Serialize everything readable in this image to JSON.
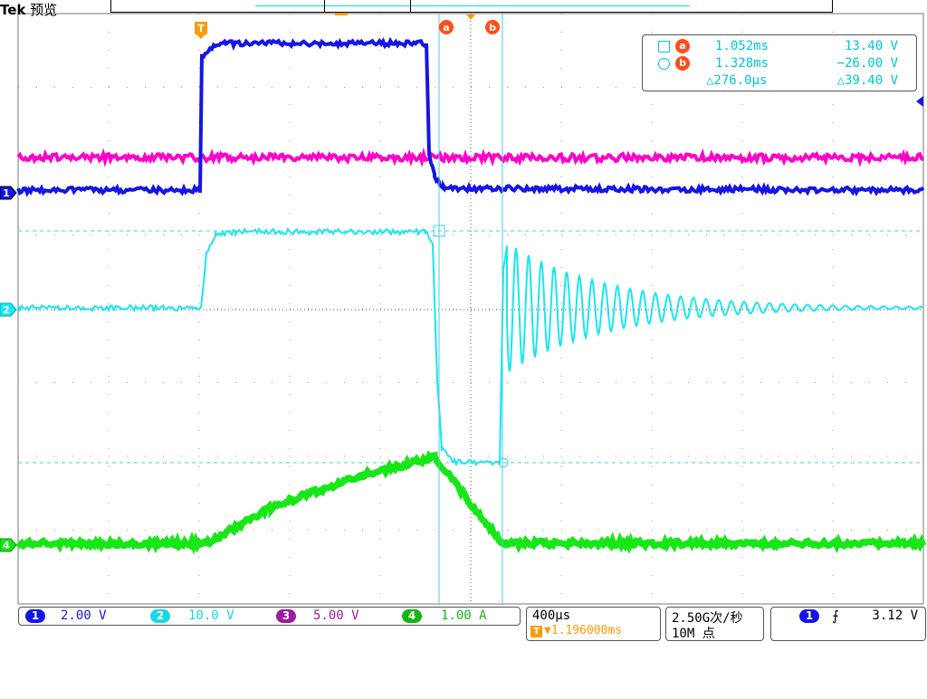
{
  "header": {
    "brand": "Tek",
    "mode": "预览"
  },
  "colors": {
    "ch1": "#1515e6",
    "ch2": "#19e6f0",
    "ch3": "#ff00cc",
    "ch4": "#17e617",
    "cursor": "#3fd2e6",
    "cursor_badge": "#ff4d1a",
    "trigger": "#ff9a0a",
    "grid": "#9a9a9a"
  },
  "markers": {
    "trigger_top": "T",
    "cursor_a": "a",
    "cursor_b": "b",
    "ch1": "1",
    "ch2": "2",
    "ch4": "4"
  },
  "measurements": {
    "a_time": "1.052ms",
    "a_value": "13.40 V",
    "b_time": "1.328ms",
    "b_value": "−26.00 V",
    "delta_time": "△276.0µs",
    "delta_value": "△39.40 V"
  },
  "channels": [
    {
      "num": "1",
      "scale": "2.00 V",
      "color": "#1515e6"
    },
    {
      "num": "2",
      "scale": "10.0 V",
      "color": "#19e6f0"
    },
    {
      "num": "3",
      "scale": "5.00 V",
      "color": "#9e1a9e"
    },
    {
      "num": "4",
      "scale": "1.00 A",
      "color": "#17c417"
    }
  ],
  "timebase": {
    "scale": "400µs",
    "position": "▼1.196000ms"
  },
  "acquisition": {
    "rate": "2.50G次/秒",
    "points": "10M 点"
  },
  "trigger": {
    "source": "1",
    "slope_icon": "rising-edge-icon",
    "slope": "⨍",
    "level": "3.12 V"
  }
}
